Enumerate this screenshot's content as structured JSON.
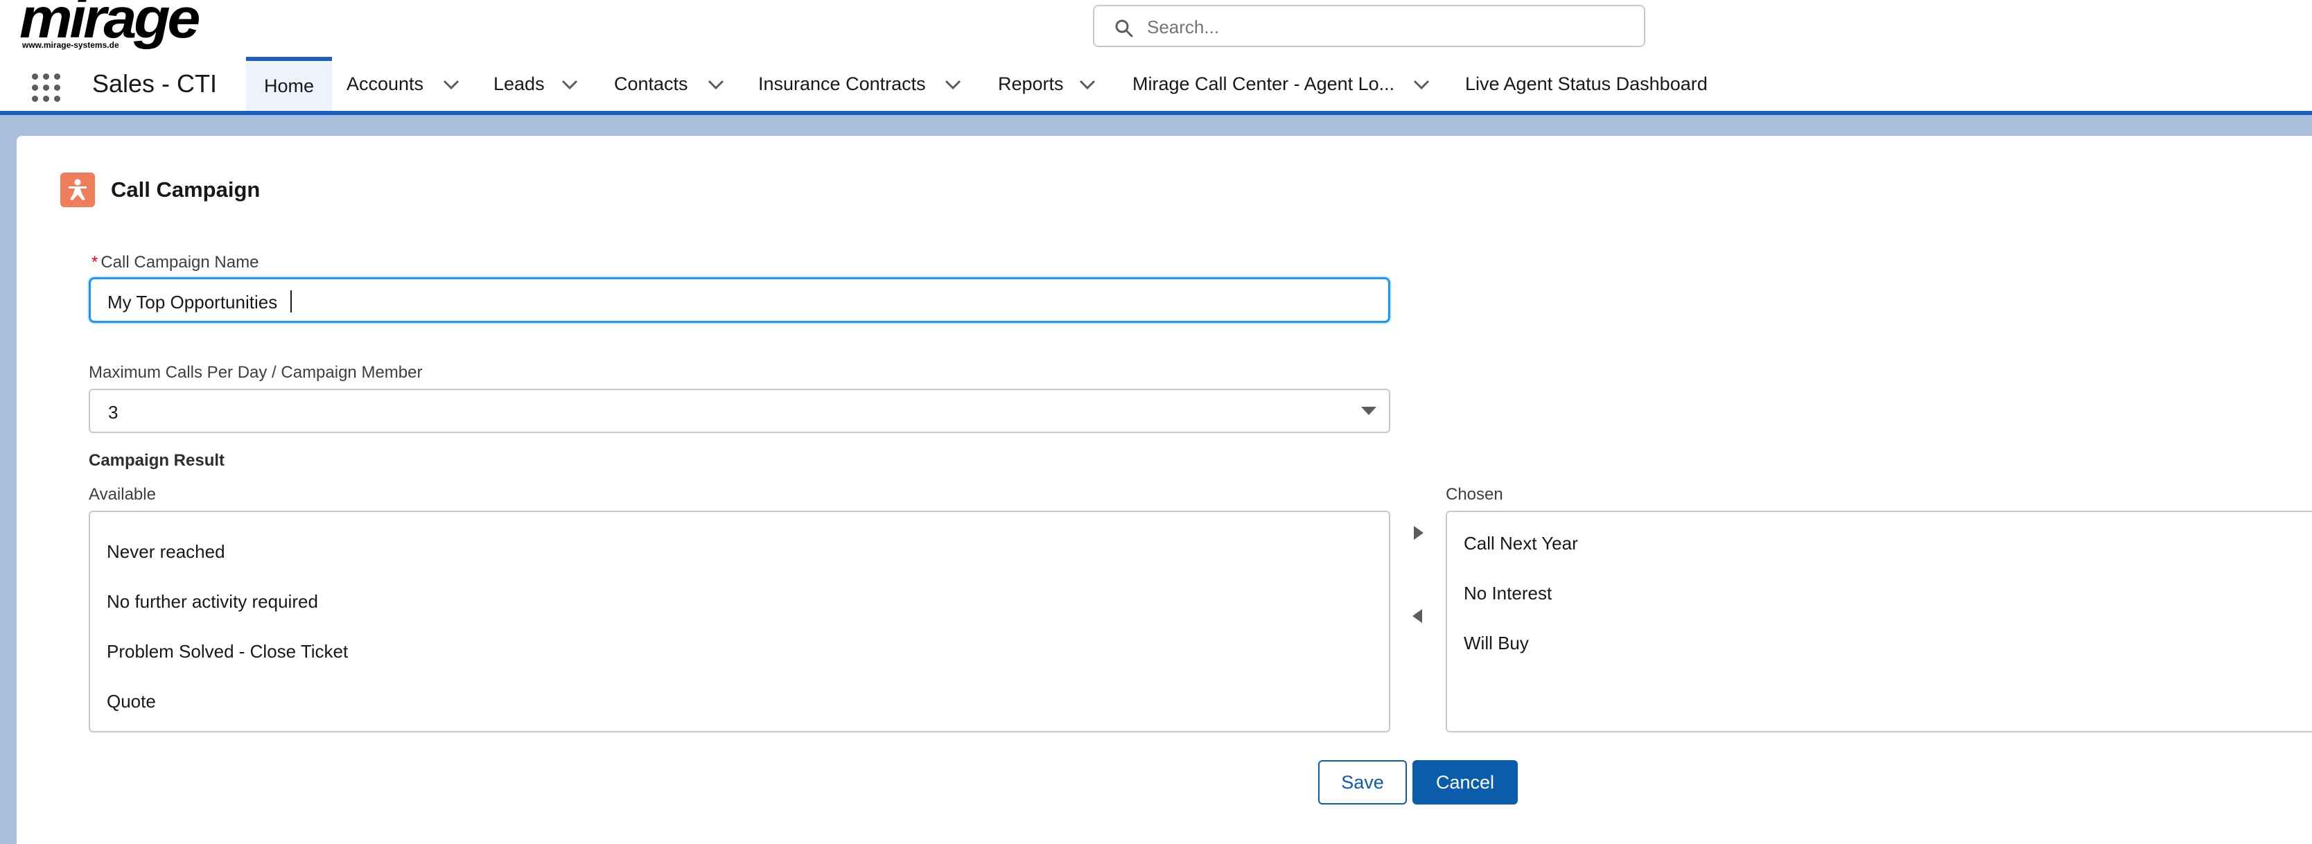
{
  "header": {
    "logo_text": "mirage",
    "logo_url_text": "www.mirage-systems.de",
    "search_placeholder": "Search..."
  },
  "nav": {
    "app_name": "Sales - CTI",
    "tabs": [
      {
        "label": "Home",
        "active": true
      },
      {
        "label": "Accounts"
      },
      {
        "label": "Leads"
      },
      {
        "label": "Contacts"
      },
      {
        "label": "Insurance Contracts"
      },
      {
        "label": "Reports"
      },
      {
        "label": "Mirage Call Center - Agent Lo..."
      },
      {
        "label": "Live Agent Status Dashboard"
      }
    ]
  },
  "form": {
    "title": "Call Campaign",
    "name_label": "Call Campaign Name",
    "required_marker": "*",
    "name_value": "My Top Opportunities",
    "max_calls_label": "Maximum Calls Per Day / Campaign Member",
    "max_calls_value": "3",
    "result_section": "Campaign Result",
    "available_label": "Available",
    "chosen_label": "Chosen",
    "available_options": [
      "Never reached",
      "No further activity required",
      "Problem Solved - Close Ticket",
      "Quote"
    ],
    "chosen_options": [
      "Call Next Year",
      "No Interest",
      "Will Buy"
    ],
    "save_label": "Save",
    "cancel_label": "Cancel"
  },
  "colors": {
    "brand_blue": "#0b5cab",
    "nav_accent": "#1b5fc1",
    "background_band": "#a9bfdb",
    "record_icon": "#ef7c5a",
    "required": "#ea001e"
  },
  "icons": [
    "search-icon",
    "app-launcher-icon",
    "chevron-down-icon",
    "campaign-icon",
    "move-right-icon",
    "move-left-icon",
    "caret-down-icon"
  ]
}
